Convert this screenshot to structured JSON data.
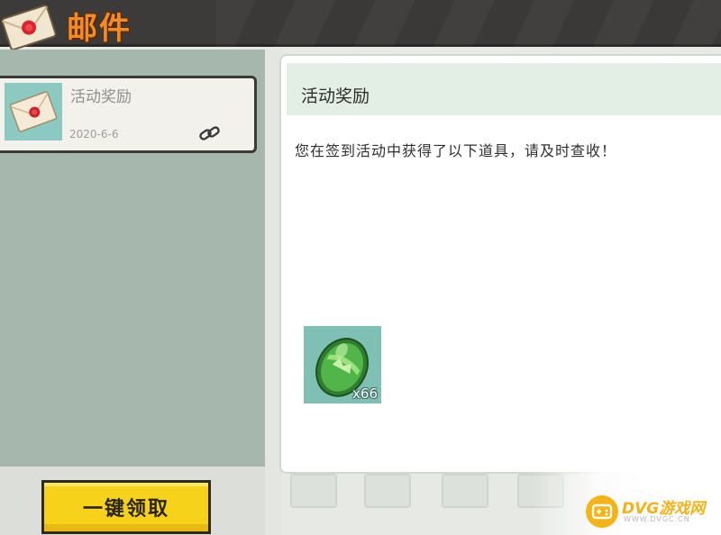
{
  "header": {
    "title": "邮件",
    "icon": "envelope-icon"
  },
  "mail_list": {
    "items": [
      {
        "title": "活动奖励",
        "date": "2020-6-6",
        "thumb_icon": "envelope-icon",
        "attachment_icon": "paperclip-icon"
      }
    ]
  },
  "actions": {
    "claim_all_label": "一键领取"
  },
  "detail": {
    "title": "活动奖励",
    "body": "您在签到活动中获得了以下道具，请及时查收！",
    "rewards": [
      {
        "icon": "green-gem-egg-icon",
        "count": "x66"
      }
    ]
  },
  "watermark": {
    "brand": "DVG游戏网",
    "url": "WWW.DVGC.CN"
  },
  "colors": {
    "header_bg": "#3d3b39",
    "title_orange": "#f28c2a",
    "list_bg": "#a6b7ad",
    "button_yellow": "#f7d21b",
    "title_bar_green": "#e3eee5",
    "item_teal": "#7fc0b4"
  }
}
